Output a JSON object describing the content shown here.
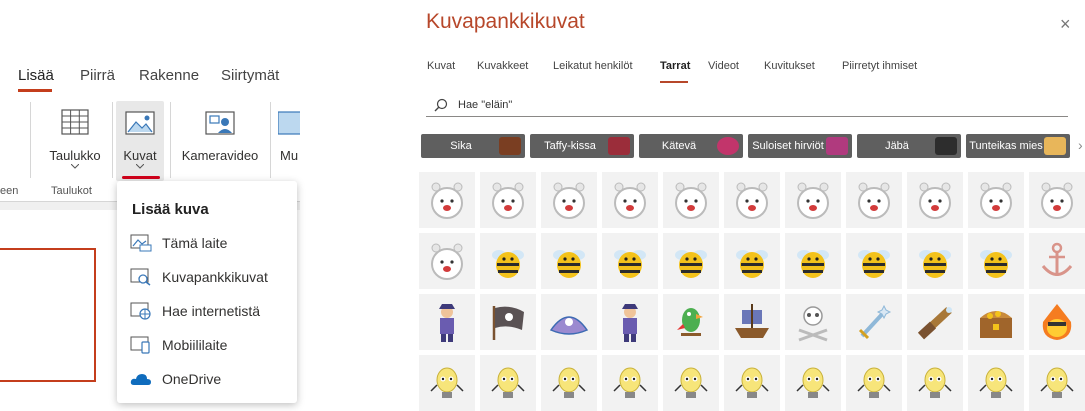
{
  "ribbon": {
    "tabs": [
      {
        "label": "Lisää",
        "active": true
      },
      {
        "label": "Piirrä",
        "active": false
      },
      {
        "label": "Rakenne",
        "active": false
      },
      {
        "label": "Siirtymät",
        "active": false
      }
    ],
    "buttons": {
      "table": "Taulukko",
      "pictures": "Kuvat",
      "camera": "Kameravideo",
      "media_partial": "Mu"
    },
    "group_labels": {
      "left_partial": "een",
      "tables": "Taulukot"
    }
  },
  "insert_picture_menu": {
    "title": "Lisää kuva",
    "items": [
      {
        "label": "Tämä laite",
        "icon": "device-picture-icon"
      },
      {
        "label": "Kuvapankkikuvat",
        "icon": "stock-images-icon"
      },
      {
        "label": "Hae internetistä",
        "icon": "online-picture-icon"
      },
      {
        "label": "Mobiililaite",
        "icon": "mobile-device-icon"
      },
      {
        "label": "OneDrive",
        "icon": "onedrive-cloud-icon"
      }
    ]
  },
  "stock_dialog": {
    "title": "Kuvapankkikuvat",
    "close_glyph": "×",
    "tabs": [
      {
        "label": "Kuvat",
        "active": false
      },
      {
        "label": "Kuvakkeet",
        "active": false
      },
      {
        "label": "Leikatut henkilöt",
        "active": false
      },
      {
        "label": "Tarrat",
        "active": true
      },
      {
        "label": "Videot",
        "active": false
      },
      {
        "label": "Kuvitukset",
        "active": false
      },
      {
        "label": "Piirretyt ihmiset",
        "active": false
      }
    ],
    "search": {
      "value": "Hae \"eläin\""
    },
    "chips": [
      {
        "label": "Sika"
      },
      {
        "label": "Taffy-kissa"
      },
      {
        "label": "Kätevä"
      },
      {
        "label": "Suloiset hirviöt"
      },
      {
        "label": "Jäbä"
      },
      {
        "label": "Tunteikas mies"
      }
    ],
    "next_glyph": "›",
    "sticker_rows": [
      [
        "alarm-clock-sticker",
        "alarm-clock-sticker",
        "alarm-clock-sticker",
        "alarm-clock-sticker",
        "alarm-clock-sticker",
        "alarm-clock-sticker",
        "alarm-clock-sticker",
        "alarm-clock-sticker",
        "alarm-clock-sticker",
        "alarm-clock-sticker",
        "alarm-clock-sticker"
      ],
      [
        "alarm-clock-sticker",
        "bee-sticker",
        "bee-sticker",
        "bee-sticker",
        "bee-sticker",
        "bee-sticker",
        "bee-sticker",
        "bee-sticker",
        "bee-sticker",
        "bee-sticker",
        "anchor-sticker"
      ],
      [
        "pirate-sticker",
        "pirate-flag-sticker",
        "pirate-hat-sticker",
        "pirate-sticker",
        "parrot-sticker",
        "pirate-ship-sticker",
        "skull-crossbones-sticker",
        "sword-sticker",
        "spyglass-sticker",
        "treasure-chest-sticker",
        "fire-face-sticker"
      ],
      [
        "bulb-character-sticker",
        "bulb-character-sticker",
        "bulb-character-sticker",
        "bulb-character-sticker",
        "bulb-character-sticker",
        "bulb-character-sticker",
        "bulb-character-sticker",
        "bulb-character-sticker",
        "bulb-character-sticker",
        "bulb-character-sticker",
        "bulb-character-sticker"
      ]
    ]
  },
  "colors": {
    "accent": "#c43e1c",
    "dialog_title": "#b7472a",
    "chip_bg": "#5f5f5f",
    "onedrive": "#0f6cbd",
    "tile_bg": "#f2f2f2"
  }
}
